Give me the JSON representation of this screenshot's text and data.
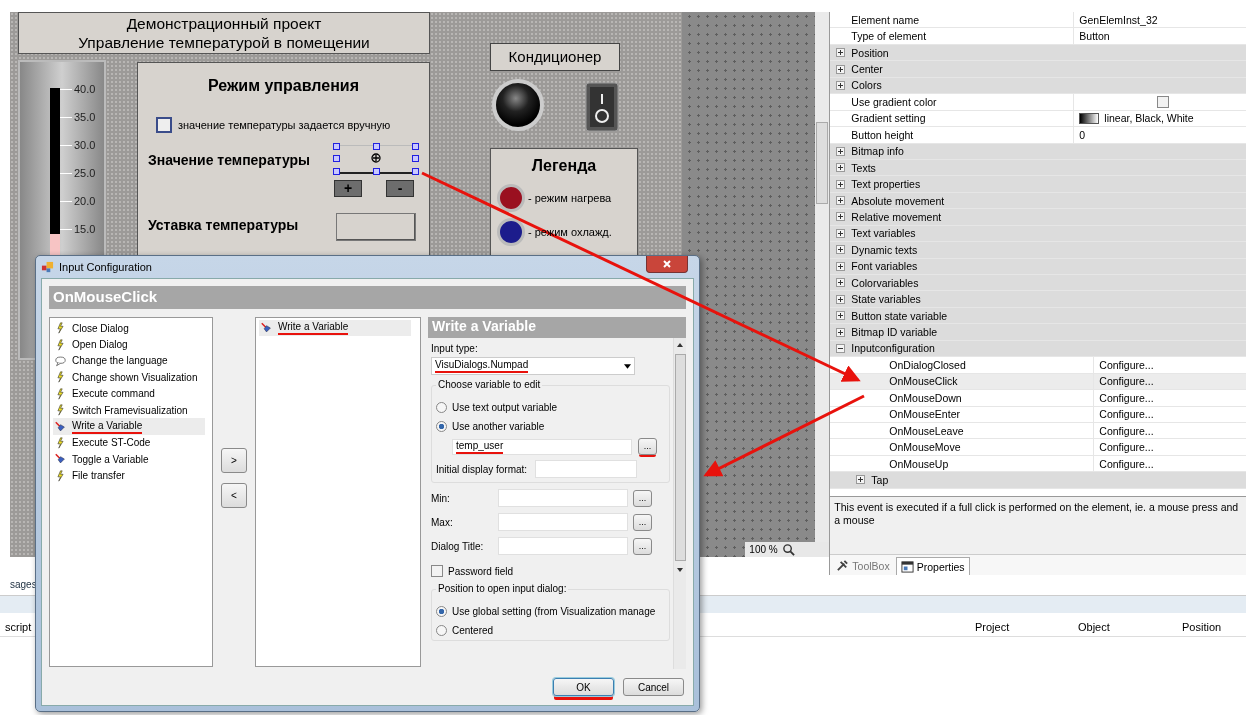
{
  "editor": {
    "title_lines": [
      "Демонстрационный проект",
      "Управление температурой в помещении"
    ],
    "thermometer": {
      "scale": [
        "40.0",
        "35.0",
        "30.0",
        "25.0",
        "20.0",
        "15.0"
      ],
      "level": 0.44
    },
    "mode_panel": {
      "title": "Режим управления",
      "manual": {
        "label": "значение температуры задается вручную",
        "checked": false
      },
      "value_label": "Значение температуры",
      "plus": "+",
      "minus": "-",
      "setpoint_label": "Уставка температуры"
    },
    "ac_label": "Кондиционер",
    "legend": {
      "title": "Легенда",
      "items": [
        {
          "label": "- режим нагрева",
          "color": "#9a1020"
        },
        {
          "label": "- режим охлажд.",
          "color": "#1c1c8c"
        }
      ]
    },
    "zoom": "100 %"
  },
  "properties": {
    "rows": [
      {
        "kind": "value",
        "name": "Element name",
        "value": "GenElemInst_32"
      },
      {
        "kind": "value",
        "name": "Type of element",
        "value": "Button"
      },
      {
        "kind": "group",
        "name": "Position",
        "expanded": false
      },
      {
        "kind": "group",
        "name": "Center",
        "expanded": false
      },
      {
        "kind": "group",
        "name": "Colors",
        "expanded": false
      },
      {
        "kind": "checkbox",
        "name": "Use gradient color",
        "checked": false
      },
      {
        "kind": "gradient",
        "name": "Gradient setting",
        "value": "linear, Black, White"
      },
      {
        "kind": "value",
        "name": "Button height",
        "value": "0"
      },
      {
        "kind": "group",
        "name": "Bitmap info",
        "expanded": false
      },
      {
        "kind": "group",
        "name": "Texts",
        "expanded": false
      },
      {
        "kind": "group",
        "name": "Text properties",
        "expanded": false
      },
      {
        "kind": "group",
        "name": "Absolute movement",
        "expanded": false
      },
      {
        "kind": "group",
        "name": "Relative movement",
        "expanded": false
      },
      {
        "kind": "group",
        "name": "Text variables",
        "expanded": false
      },
      {
        "kind": "group",
        "name": "Dynamic texts",
        "expanded": false
      },
      {
        "kind": "group",
        "name": "Font variables",
        "expanded": false
      },
      {
        "kind": "group",
        "name": "Colorvariables",
        "expanded": false
      },
      {
        "kind": "group",
        "name": "State variables",
        "expanded": false
      },
      {
        "kind": "group",
        "name": "Button state variable",
        "expanded": false
      },
      {
        "kind": "group",
        "name": "Bitmap ID variable",
        "expanded": false
      },
      {
        "kind": "group",
        "name": "Inputconfiguration",
        "expanded": true,
        "children": [
          {
            "kind": "event",
            "name": "OnDialogClosed",
            "value": "Configure...",
            "selected": false
          },
          {
            "kind": "event",
            "name": "OnMouseClick",
            "value": "Configure...",
            "selected": true
          },
          {
            "kind": "event",
            "name": "OnMouseDown",
            "value": "Configure...",
            "selected": false
          },
          {
            "kind": "event",
            "name": "OnMouseEnter",
            "value": "Configure...",
            "selected": false
          },
          {
            "kind": "event",
            "name": "OnMouseLeave",
            "value": "Configure...",
            "selected": false
          },
          {
            "kind": "event",
            "name": "OnMouseMove",
            "value": "Configure...",
            "selected": false
          },
          {
            "kind": "event",
            "name": "OnMouseUp",
            "value": "Configure...",
            "selected": false
          },
          {
            "kind": "group",
            "name": "Tap",
            "expanded": false
          }
        ]
      }
    ],
    "description": "This event is executed if a full click is performed on the element, ie. a mouse press and a mouse",
    "tabs": [
      {
        "label": "ToolBox",
        "kind": "tools",
        "selected": false
      },
      {
        "label": "Properties",
        "kind": "properties",
        "selected": true
      }
    ]
  },
  "messages": {
    "tab": "sages",
    "columns": [
      "script",
      "Project",
      "Object",
      "Position"
    ]
  },
  "dialog": {
    "title": "Input Configuration",
    "event": "OnMouseClick",
    "actions": [
      {
        "label": "Close Dialog",
        "kind": "bolt",
        "selected": false,
        "underlined": false
      },
      {
        "label": "Open Dialog",
        "kind": "bolt",
        "selected": false,
        "underlined": false
      },
      {
        "label": "Change the language",
        "kind": "speech",
        "selected": false,
        "underlined": false
      },
      {
        "label": "Change shown Visualization",
        "kind": "bolt",
        "selected": false,
        "underlined": false
      },
      {
        "label": "Execute command",
        "kind": "bolt",
        "selected": false,
        "underlined": false
      },
      {
        "label": "Switch Framevisualization",
        "kind": "bolt",
        "selected": false,
        "underlined": false
      },
      {
        "label": "Write a Variable",
        "kind": "variable",
        "selected": true,
        "underlined": true
      },
      {
        "label": "Execute ST-Code",
        "kind": "bolt",
        "selected": false,
        "underlined": false
      },
      {
        "label": "Toggle a Variable",
        "kind": "variable",
        "selected": false,
        "underlined": false
      },
      {
        "label": "File transfer",
        "kind": "bolt",
        "selected": false,
        "underlined": false
      }
    ],
    "move_buttons": [
      ">",
      "<"
    ],
    "chosen": [
      {
        "label": "Write a Variable",
        "kind": "variable",
        "selected": true,
        "underlined": true
      }
    ],
    "config": {
      "title": "Write a Variable",
      "input_type": {
        "label": "Input type:",
        "value": "VisuDialogs.Numpad",
        "underlined": true
      },
      "variable_group": {
        "legend": "Choose variable to edit",
        "options": [
          {
            "label": "Use text output variable",
            "selected": false
          },
          {
            "label": "Use another variable",
            "selected": true
          }
        ],
        "variable": {
          "value": "temp_user",
          "underlined": true
        },
        "browse": {
          "label": "...",
          "underlined": true
        },
        "format_label": "Initial display format:"
      },
      "fields": [
        {
          "label": "Min:",
          "browse": "..."
        },
        {
          "label": "Max:",
          "browse": "..."
        },
        {
          "label": "Dialog Title:",
          "browse": "..."
        }
      ],
      "password": {
        "label": "Password field",
        "checked": false
      },
      "position_group": {
        "legend": "Position to open input dialog:",
        "options": [
          {
            "label": "Use global setting (from Visualization manage",
            "selected": true
          },
          {
            "label": "Centered",
            "selected": false
          }
        ]
      }
    },
    "buttons": [
      {
        "label": "OK",
        "default": true,
        "underlined": true
      },
      {
        "label": "Cancel",
        "default": false,
        "underlined": false
      }
    ]
  }
}
